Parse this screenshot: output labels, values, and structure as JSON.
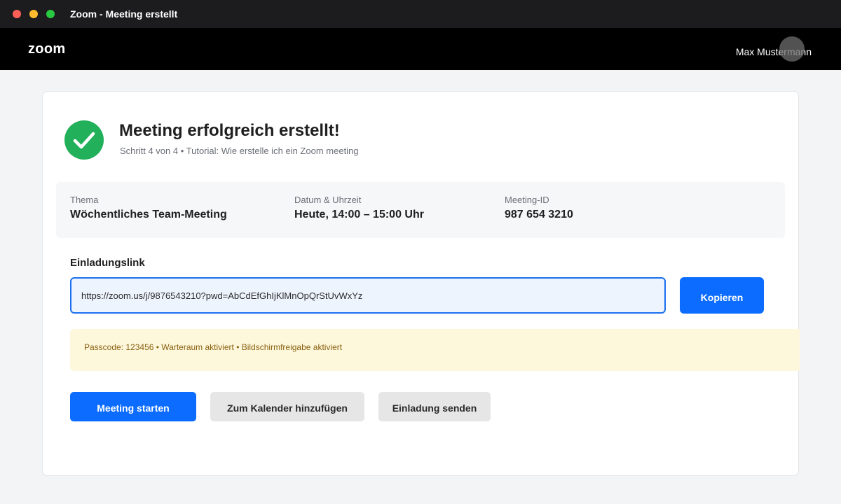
{
  "window": {
    "title": "Zoom - Meeting erstellt"
  },
  "header": {
    "logo": "zoom",
    "user_name": "Max Mustermann"
  },
  "success": {
    "icon": "checkmark-circle-icon",
    "title": "Meeting erfolgreich erstellt!",
    "subtitle": "Schritt 4 von 4 • Tutorial: Wie erstelle ich ein Zoom meeting"
  },
  "details": {
    "topic_label": "Thema",
    "topic_value": "Wöchentliches Team-Meeting",
    "datetime_label": "Datum & Uhrzeit",
    "datetime_value": "Heute, 14:00 – 15:00 Uhr",
    "id_label": "Meeting-ID",
    "id_value": "987 654 3210"
  },
  "invite": {
    "label": "Einladungslink",
    "link": "https://zoom.us/j/9876543210?pwd=AbCdEfGhIjKlMnOpQrStUvWxYz",
    "copy_label": "Kopieren"
  },
  "notice": {
    "text": "Passcode: 123456 • Warteraum aktiviert • Bildschirmfreigabe aktiviert"
  },
  "actions": {
    "start_label": "Meeting starten",
    "calendar_label": "Zum Kalender hinzufügen",
    "invite_label": "Einladung senden"
  },
  "colors": {
    "accent": "#0b6cff",
    "success": "#22b05a",
    "notice_bg": "#fdf7dc",
    "notice_text": "#8a6210"
  }
}
